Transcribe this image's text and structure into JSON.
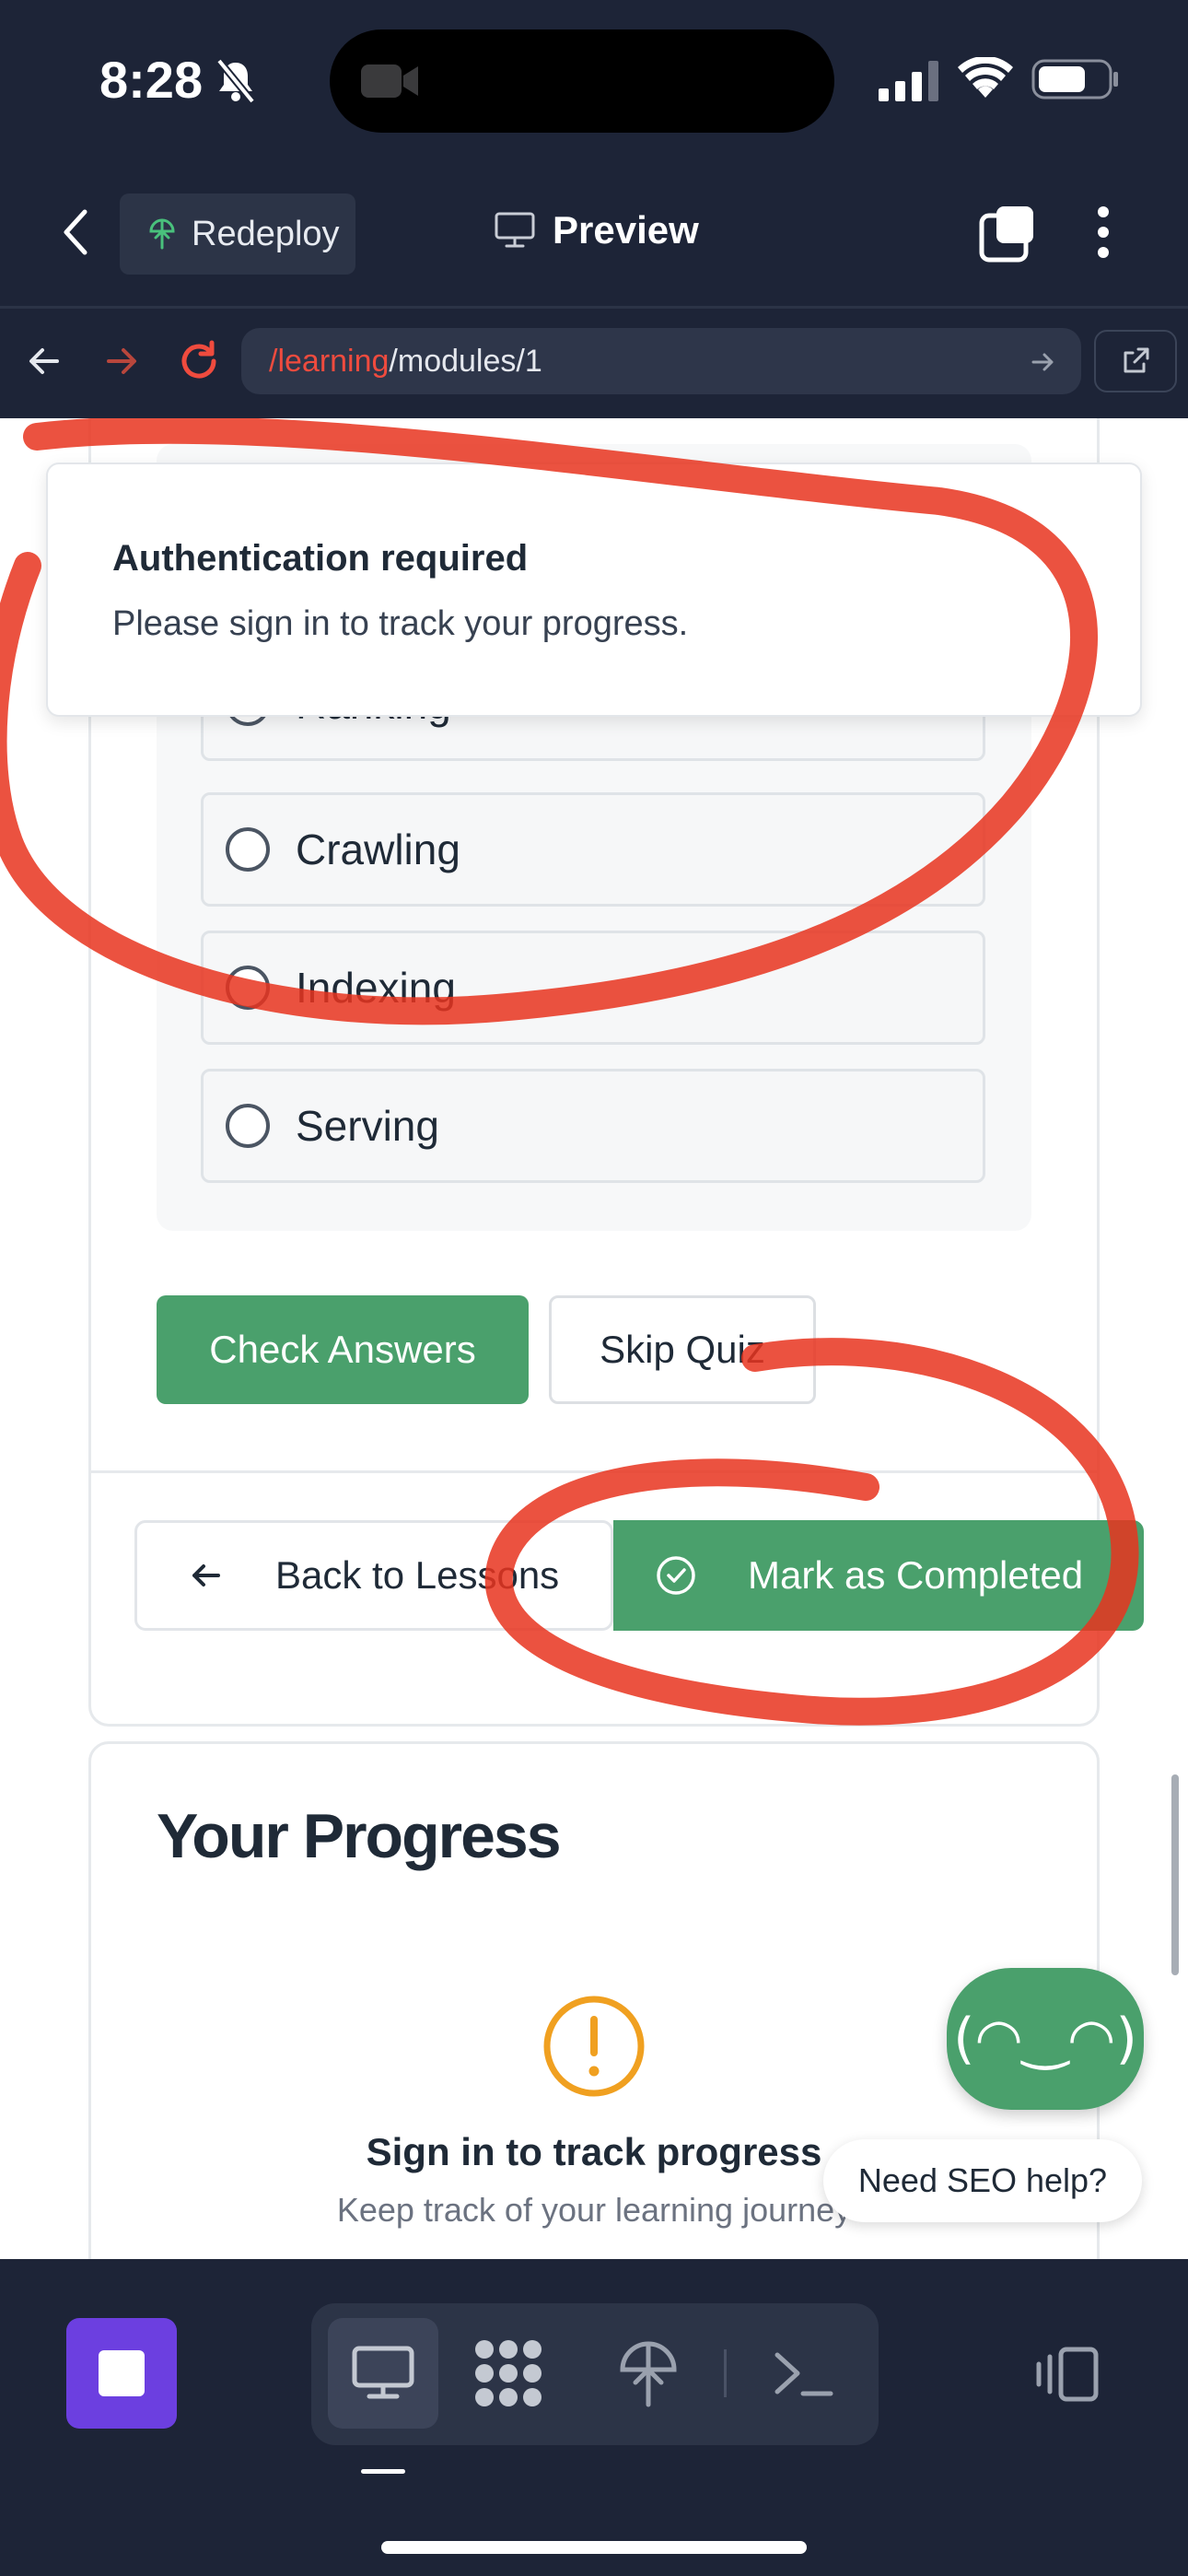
{
  "status_bar": {
    "time": "8:28"
  },
  "top_bar": {
    "redeploy_label": "Redeploy",
    "preview_label": "Preview"
  },
  "browser": {
    "url_path_accent": "/learning",
    "url_path_rest": "/modules/1"
  },
  "toast": {
    "title": "Authentication required",
    "message": "Please sign in to track your progress."
  },
  "quiz": {
    "options": [
      {
        "label": "Ranking"
      },
      {
        "label": "Crawling"
      },
      {
        "label": "Indexing"
      },
      {
        "label": "Serving"
      }
    ],
    "check_answers_label": "Check Answers",
    "skip_quiz_label": "Skip Quiz"
  },
  "lesson_nav": {
    "back_label": "Back to Lessons",
    "mark_completed_label": "Mark as Completed"
  },
  "progress": {
    "title": "Your Progress",
    "signin_title": "Sign in to track progress",
    "signin_subtitle": "Keep track of your learning journey"
  },
  "assistant": {
    "face": "(◠‿◠)",
    "help_label": "Need SEO help?"
  },
  "colors": {
    "accent_green": "#4aa06c",
    "annotation_red": "#e8341f",
    "app_dark": "#1d2437",
    "stop_purple": "#6c3fe0",
    "warning_amber": "#f0a020"
  }
}
